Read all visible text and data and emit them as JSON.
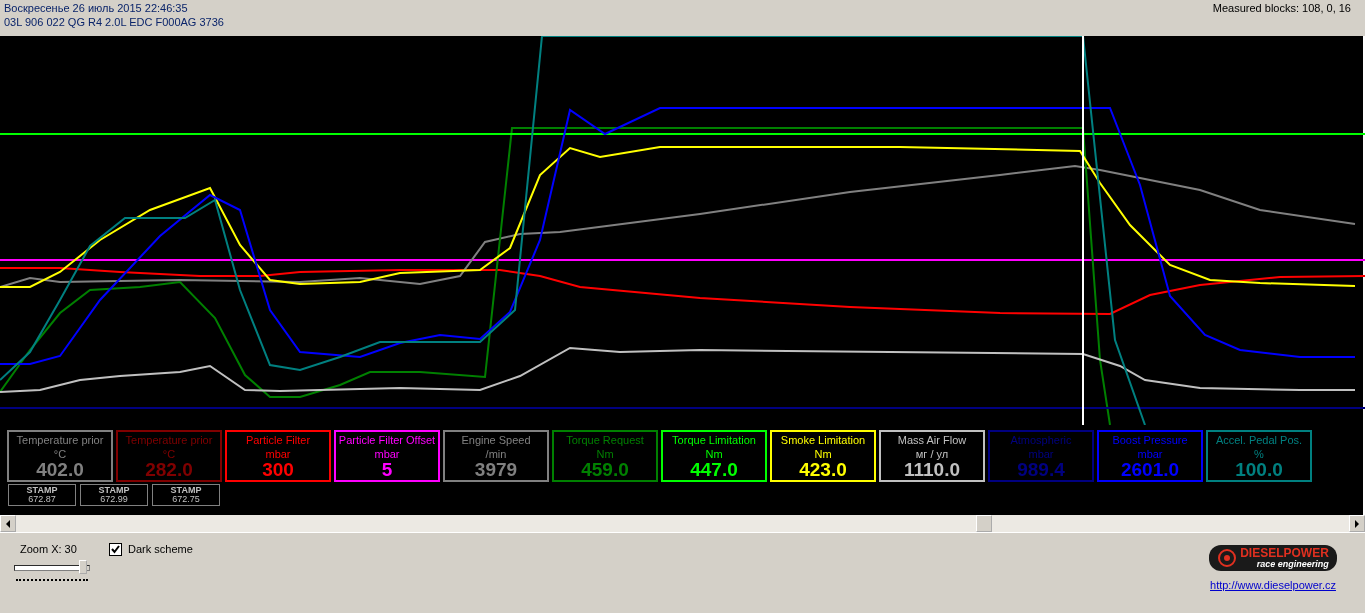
{
  "header": {
    "date": "Воскресенье 26 июль 2015 22:46:35",
    "ecu": "03L 906 022 QG  R4 2.0L EDC F000AG  3736",
    "blocks": "Measured blocks: 108, 0, 16"
  },
  "cards": [
    {
      "name": "Temperature prior",
      "unit": "°C",
      "value": "402.0",
      "color": "#808080"
    },
    {
      "name": "Temperature prior",
      "unit": "°C",
      "value": "282.0",
      "color": "#800000"
    },
    {
      "name": "Particle Filter",
      "unit": "mbar",
      "value": "300",
      "color": "#ff0000"
    },
    {
      "name": "Particle Filter Offset",
      "unit": "mbar",
      "value": "5",
      "color": "#ff00ff"
    },
    {
      "name": "Engine Speed",
      "unit": "/min",
      "value": "3979",
      "color": "#808080"
    },
    {
      "name": "Torque Request",
      "unit": "Nm",
      "value": "459.0",
      "color": "#008000"
    },
    {
      "name": "Torque Limitation",
      "unit": "Nm",
      "value": "447.0",
      "color": "#00ff00"
    },
    {
      "name": "Smoke Limitation",
      "unit": "Nm",
      "value": "423.0",
      "color": "#ffff00"
    },
    {
      "name": "Mass Air Flow",
      "unit": "мг / ул",
      "value": "1110.0",
      "color": "#c0c0c0"
    },
    {
      "name": "Atmospheric",
      "unit": "mbar",
      "value": "989.4",
      "color": "#000080"
    },
    {
      "name": "Boost Pressure",
      "unit": "mbar",
      "value": "2601.0",
      "color": "#0000ff"
    },
    {
      "name": "Accel. Pedal Pos.",
      "unit": "%",
      "value": "100.0",
      "color": "#008080"
    }
  ],
  "stamps": [
    {
      "label": "STAMP",
      "value": "672.87"
    },
    {
      "label": "STAMP",
      "value": "672.99"
    },
    {
      "label": "STAMP",
      "value": "672.75"
    }
  ],
  "zoom": {
    "label": "Zoom X: 30",
    "level": 0.95
  },
  "dark_scheme": {
    "label": "Dark scheme",
    "checked": true
  },
  "logo": {
    "brand": "DIESELPOWER",
    "tagline": "race engineering"
  },
  "link": "http://www.dieselpower.cz"
}
